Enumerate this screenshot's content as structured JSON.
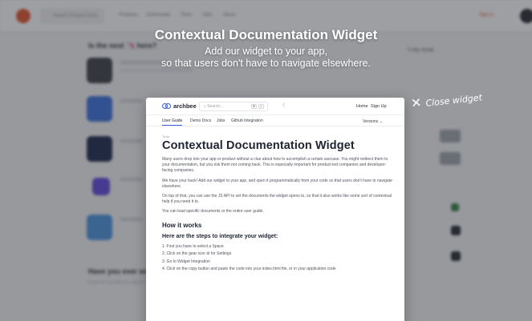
{
  "background": {
    "search_placeholder": "Search Product Hunt",
    "nav_links": [
      "Products",
      "Community",
      "Tools",
      "Jobs",
      "About"
    ],
    "sign_in": "Sign in",
    "section_heading": "Is the next 🦄 here?",
    "items": [
      {
        "title": "Topics Guide for...",
        "meta": "Computer Hardware"
      },
      {
        "title": "Diarist",
        "meta": "Productivity"
      },
      {
        "title": "Freq.ai",
        "meta": "Productivity"
      },
      {
        "title": "Hantla",
        "meta": "Developer Tools"
      },
      {
        "title": "Speed writer",
        "meta": "Tech"
      }
    ],
    "right_label": "5 day streak",
    "bottom_heading": "Have you ever wondered...",
    "bottom_sub": "If you've ever felt you had to navigate elsewhere...",
    "colors": {
      "brand": "#d9532f",
      "nav_bg": "#f5f5f6"
    }
  },
  "promo": {
    "title": "Contextual Documentation Widget",
    "subtitle_line1": "Add our widget to your app,",
    "subtitle_line2": "so that users don't have to navigate elsewhere."
  },
  "close_widget": {
    "icon": "close-icon",
    "label": "Close widget"
  },
  "widget": {
    "brand": "archbee",
    "search_placeholder": "Search...",
    "kbd_keys": [
      "⌘",
      "K"
    ],
    "top_links": [
      "Home",
      "Sign Up"
    ],
    "tabs": [
      {
        "label": "User Guide",
        "active": true
      },
      {
        "label": "Demo Docs",
        "active": false
      },
      {
        "label": "Jobs",
        "active": false
      },
      {
        "label": "Github Integration",
        "active": false
      }
    ],
    "versions": "Versions",
    "breadcrumb": "Tools",
    "title": "Contextual Documentation Widget",
    "paragraphs": [
      "Many users drop into your app or product without a clue about how to accomplish a certain usecase. You might redirect them to your documentation, but you risk them not coming back. This is especially important for product-led companies and developer-facing companies.",
      "We have your back! Add our widget to your app, and open it programmatically from your code so that users don't have to navigate elsewhere.",
      "On top of that, you can use the JS API to set the documents the widget opens to, so that it also works like some sort of contextual help if you need it to.",
      "You can load specific documents or the entire user guide."
    ],
    "how_it_works": "How it works",
    "steps_heading": "Here are the steps to integrate your widget:",
    "steps": [
      "1. First you have to select a Space",
      "2. Click on the gear icon ⚙ for Settings",
      "3. Go to Widget Integration",
      "4. Click on the copy button and paste the code into your index.html file, or in your application code"
    ],
    "accent": "#3b5bdb"
  }
}
